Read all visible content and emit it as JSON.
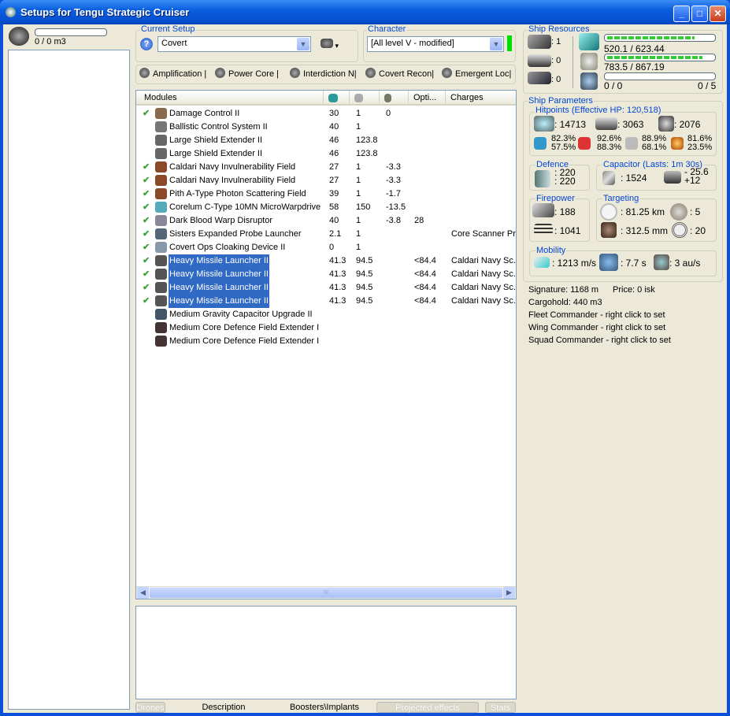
{
  "window": {
    "title": "Setups for Tengu Strategic Cruiser",
    "min": "_",
    "max": "□",
    "close": "✕"
  },
  "cargo": {
    "text": "0 / 0 m3"
  },
  "current_setup": {
    "label": "Current Setup",
    "value": "Covert"
  },
  "character": {
    "label": "Character",
    "value": "[All level V - modified]",
    "status_color": "#00dd00"
  },
  "subsystems": [
    "Amplification |",
    "Power Core |",
    "Interdiction N|",
    "Covert Recon|",
    "Emergent Loc|"
  ],
  "modules": {
    "headers": [
      "Modules",
      "",
      "",
      "",
      "Opti...",
      "Charges"
    ],
    "rows": [
      {
        "check": true,
        "name": "Damage Control II",
        "c1": "30",
        "c2": "1",
        "c3": "0",
        "c4": "",
        "charges": "",
        "icon": "#8a6a4a",
        "sel": false
      },
      {
        "check": false,
        "name": "Ballistic Control System II",
        "c1": "40",
        "c2": "1",
        "c3": "",
        "c4": "",
        "charges": "",
        "icon": "#777",
        "sel": false
      },
      {
        "check": false,
        "name": "Large Shield Extender II",
        "c1": "46",
        "c2": "123.8",
        "c3": "",
        "c4": "",
        "charges": "",
        "icon": "#666",
        "sel": false
      },
      {
        "check": false,
        "name": "Large Shield Extender II",
        "c1": "46",
        "c2": "123.8",
        "c3": "",
        "c4": "",
        "charges": "",
        "icon": "#666",
        "sel": false
      },
      {
        "check": true,
        "name": "Caldari Navy Invulnerability Field",
        "c1": "27",
        "c2": "1",
        "c3": "-3.3",
        "c4": "",
        "charges": "",
        "icon": "#8a4a2a",
        "sel": false
      },
      {
        "check": true,
        "name": "Caldari Navy Invulnerability Field",
        "c1": "27",
        "c2": "1",
        "c3": "-3.3",
        "c4": "",
        "charges": "",
        "icon": "#8a4a2a",
        "sel": false
      },
      {
        "check": true,
        "name": "Pith A-Type Photon Scattering Field",
        "c1": "39",
        "c2": "1",
        "c3": "-1.7",
        "c4": "",
        "charges": "",
        "icon": "#8a4a2a",
        "sel": false
      },
      {
        "check": true,
        "name": "Corelum C-Type 10MN MicroWarpdrive",
        "c1": "58",
        "c2": "150",
        "c3": "-13.5",
        "c4": "",
        "charges": "",
        "icon": "#5ab",
        "sel": false
      },
      {
        "check": true,
        "name": "Dark Blood Warp Disruptor",
        "c1": "40",
        "c2": "1",
        "c3": "-3.8",
        "c4": "28",
        "charges": "",
        "icon": "#889",
        "sel": false
      },
      {
        "check": true,
        "name": "Sisters Expanded Probe Launcher",
        "c1": "2.1",
        "c1b": "",
        "c2": "1",
        "c3": "",
        "c4": "",
        "charges": "Core Scanner Pr.",
        "icon": "#567",
        "sel": false
      },
      {
        "check": true,
        "name": "Covert Ops Cloaking Device II",
        "c1": "0",
        "c2": "1",
        "c3": "",
        "c4": "",
        "charges": "",
        "icon": "#89a",
        "sel": false
      },
      {
        "check": true,
        "name": "Heavy Missile Launcher II",
        "c1": "41.3",
        "c2": "94.5",
        "c3": "",
        "c4": "<84.4",
        "charges": "Caldari Navy Sc..",
        "icon": "#555",
        "sel": true
      },
      {
        "check": true,
        "name": "Heavy Missile Launcher II",
        "c1": "41.3",
        "c2": "94.5",
        "c3": "",
        "c4": "<84.4",
        "charges": "Caldari Navy Sc..",
        "icon": "#555",
        "sel": true
      },
      {
        "check": true,
        "name": "Heavy Missile Launcher II",
        "c1": "41.3",
        "c2": "94.5",
        "c3": "",
        "c4": "<84.4",
        "charges": "Caldari Navy Sc..",
        "icon": "#555",
        "sel": true
      },
      {
        "check": true,
        "name": "Heavy Missile Launcher II",
        "c1": "41.3",
        "c2": "94.5",
        "c3": "",
        "c4": "<84.4",
        "charges": "Caldari Navy Sc..",
        "icon": "#555",
        "sel": true
      },
      {
        "check": false,
        "name": "Medium Gravity Capacitor Upgrade II",
        "c1": "",
        "c2": "",
        "c3": "",
        "c4": "",
        "charges": "",
        "icon": "#456",
        "sel": false
      },
      {
        "check": false,
        "name": "Medium Core Defence Field Extender I",
        "c1": "",
        "c2": "",
        "c3": "",
        "c4": "",
        "charges": "",
        "icon": "#433",
        "sel": false
      },
      {
        "check": false,
        "name": "Medium Core Defence Field Extender I",
        "c1": "",
        "c2": "",
        "c3": "",
        "c4": "",
        "charges": "",
        "icon": "#433",
        "sel": false
      }
    ],
    "scroll_grip": "III"
  },
  "bottom_tabs": {
    "drones": "Drones",
    "description": "Description",
    "boosters": "Boosters\\Implants",
    "projected": "Projected effects",
    "stats": "Stats"
  },
  "resources": {
    "label": "Ship Resources",
    "turrets": ": 1",
    "launchers": ": 0",
    "rigs": ": 0",
    "cpu": "520.1 / 623.44",
    "cpu_pct": 83,
    "power": "783.5 / 867.19",
    "power_pct": 90,
    "drones_bw": "0 / 0",
    "drones_count": "0 / 5"
  },
  "params": {
    "label": "Ship Parameters",
    "hp_label": "Hitpoints (Effective HP: 120,518)",
    "shield": ": 14713",
    "armor": ": 3063",
    "structure": ": 2076",
    "res": [
      [
        "82.3%",
        "57.5%"
      ],
      [
        "92.6%",
        "88.3%"
      ],
      [
        "88.9%",
        "68.1%"
      ],
      [
        "81.6%",
        "23.5%"
      ]
    ],
    "defence_label": "Defence",
    "def1": ": 220",
    "def2": ": 220",
    "cap_label": "Capacitor (Lasts: 1m 30s)",
    "cap": ": 1524",
    "cap_use": "- 25.6",
    "cap_regen": "+12",
    "fire_label": "Firepower",
    "dps": ": 188",
    "volley": ": 1041",
    "target_label": "Targeting",
    "range": ": 81.25 km",
    "targets": ": 5",
    "scanres": ": 312.5 mm",
    "sensor": ": 20",
    "mob_label": "Mobility",
    "speed": ": 1213 m/s",
    "align": ": 7.7 s",
    "warp": ": 3 au/s",
    "signature": "Signature: 1168 m",
    "price": "Price: 0 isk",
    "cargo": "Cargohold: 440 m3",
    "fleet": "Fleet Commander - right click to set",
    "wing": "Wing Commander - right click to set",
    "squad": "Squad Commander - right click to set"
  }
}
